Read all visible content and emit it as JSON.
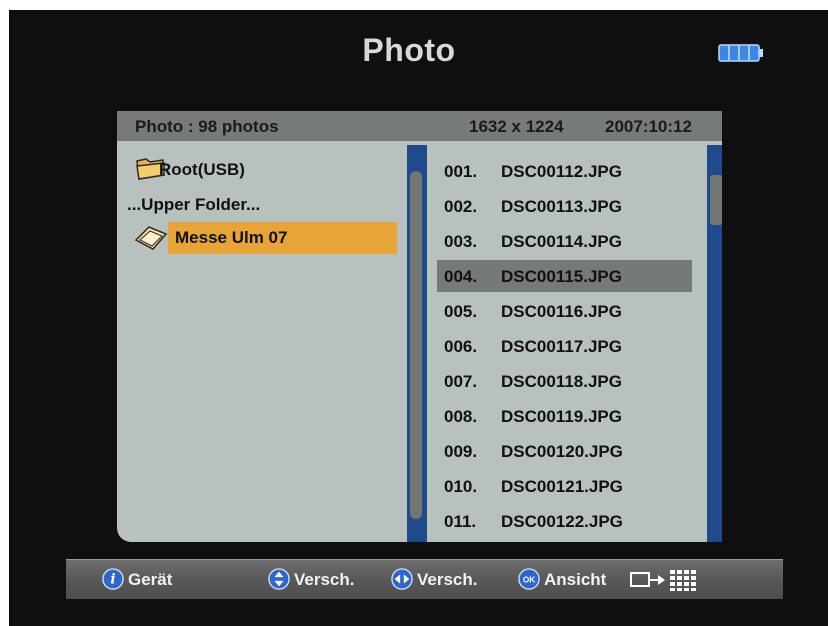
{
  "title": "Photo",
  "info": {
    "label": "Photo :  98 photos",
    "resolution": "1632 x 1224",
    "date": "2007:10:12"
  },
  "folders": [
    {
      "label": "Root(USB)",
      "icon": "folder-icon"
    },
    {
      "label": "...Upper Folder...",
      "icon": null
    },
    {
      "label": "Messe Ulm 07",
      "icon": "open-folder-icon",
      "selected": true
    }
  ],
  "files": [
    {
      "num": "001.",
      "name": "DSC00112.JPG"
    },
    {
      "num": "002.",
      "name": "DSC00113.JPG"
    },
    {
      "num": "003.",
      "name": "DSC00114.JPG"
    },
    {
      "num": "004.",
      "name": "DSC00115.JPG",
      "selected": true
    },
    {
      "num": "005.",
      "name": "DSC00116.JPG"
    },
    {
      "num": "006.",
      "name": "DSC00117.JPG"
    },
    {
      "num": "007.",
      "name": "DSC00118.JPG"
    },
    {
      "num": "008.",
      "name": "DSC00119.JPG"
    },
    {
      "num": "009.",
      "name": "DSC00120.JPG"
    },
    {
      "num": "010.",
      "name": "DSC00121.JPG"
    },
    {
      "num": "011.",
      "name": "DSC00122.JPG"
    }
  ],
  "footer": {
    "geraet": "Gerät",
    "move_updown": "Versch.",
    "move_leftright": "Versch.",
    "view": "Ansicht"
  },
  "icons": {
    "battery": "battery-icon",
    "info": "info-icon",
    "updown": "up-down-arrow-icon",
    "leftright": "left-right-arrow-icon",
    "ok": "ok-icon",
    "grid": "thumbnail-grid-icon"
  },
  "colors": {
    "background": "#0f0f0f",
    "panel": "#b9c1be",
    "infobar": "#767b78",
    "highlight_folder": "#e7a437",
    "selected_file": "#757977",
    "scrollbar": "#1f4a8c",
    "battery": "#3a86e0"
  }
}
